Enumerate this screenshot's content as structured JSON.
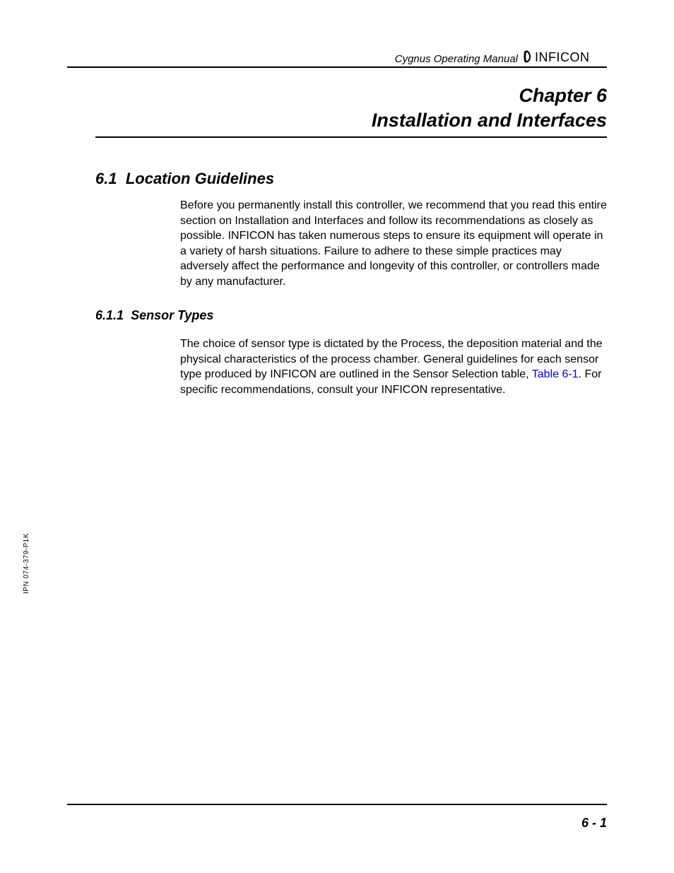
{
  "header": {
    "manual_title": "Cygnus Operating Manual",
    "logo_text": "INFICON"
  },
  "chapter": {
    "label": "Chapter 6",
    "title": "Installation and Interfaces"
  },
  "sections": {
    "s6_1": {
      "number": "6.1",
      "title": "Location Guidelines",
      "paragraph": "Before you permanently install this controller, we recommend that you read this entire section on Installation and Interfaces and follow its recommendations as closely as possible. INFICON has taken numerous steps to ensure its equipment will operate in a variety of harsh situations. Failure to adhere to these simple practices may adversely affect the performance and longevity of this controller, or controllers made by any manufacturer."
    },
    "s6_1_1": {
      "number": "6.1.1",
      "title": "Sensor Types",
      "paragraph_before_link": "The choice of sensor type is dictated by the Process, the deposition material and the physical characteristics of the process chamber. General guidelines for each sensor type produced by INFICON are outlined in the Sensor Selection table, ",
      "link_text": "Table 6-1",
      "paragraph_after_link": ". For specific recommendations, consult your INFICON representative."
    }
  },
  "side_note": "IPN 074-379-P1K",
  "page_number": "6 - 1"
}
